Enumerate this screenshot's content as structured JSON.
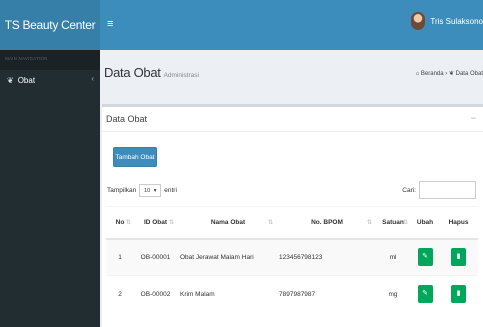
{
  "app": {
    "brand": "TS Beauty Center",
    "user_name": "Tris Sulaksono"
  },
  "sidebar": {
    "header": "MAIN NAVIGATION",
    "items": [
      {
        "label": "Obat"
      }
    ]
  },
  "page": {
    "title": "Data Obat",
    "subtitle": "Administrasi",
    "breadcrumb": [
      "Beranda",
      "Data Obat"
    ]
  },
  "box": {
    "title": "Data Obat",
    "add_button": "Tambah Obat",
    "length_prefix": "Tampilkan",
    "length_value": "10",
    "length_suffix": "entri",
    "search_label": "Cari:"
  },
  "table": {
    "columns": [
      "No",
      "ID Obat",
      "Nama Obat",
      "No. BPOM",
      "Satuan",
      "Ubah",
      "Hapus"
    ],
    "rows": [
      {
        "no": "1",
        "id": "OB-00001",
        "nama": "Obat Jerawat Malam Hari",
        "bpom": "123456798123",
        "satuan": "ml"
      },
      {
        "no": "2",
        "id": "OB-00002",
        "nama": "Krim Malam",
        "bpom": "7897987987",
        "satuan": "mg"
      }
    ]
  },
  "colors": {
    "primary": "#3c8dbc",
    "brand_bg": "#367fa9",
    "sidebar_bg": "#222d32",
    "success": "#00a65a"
  }
}
